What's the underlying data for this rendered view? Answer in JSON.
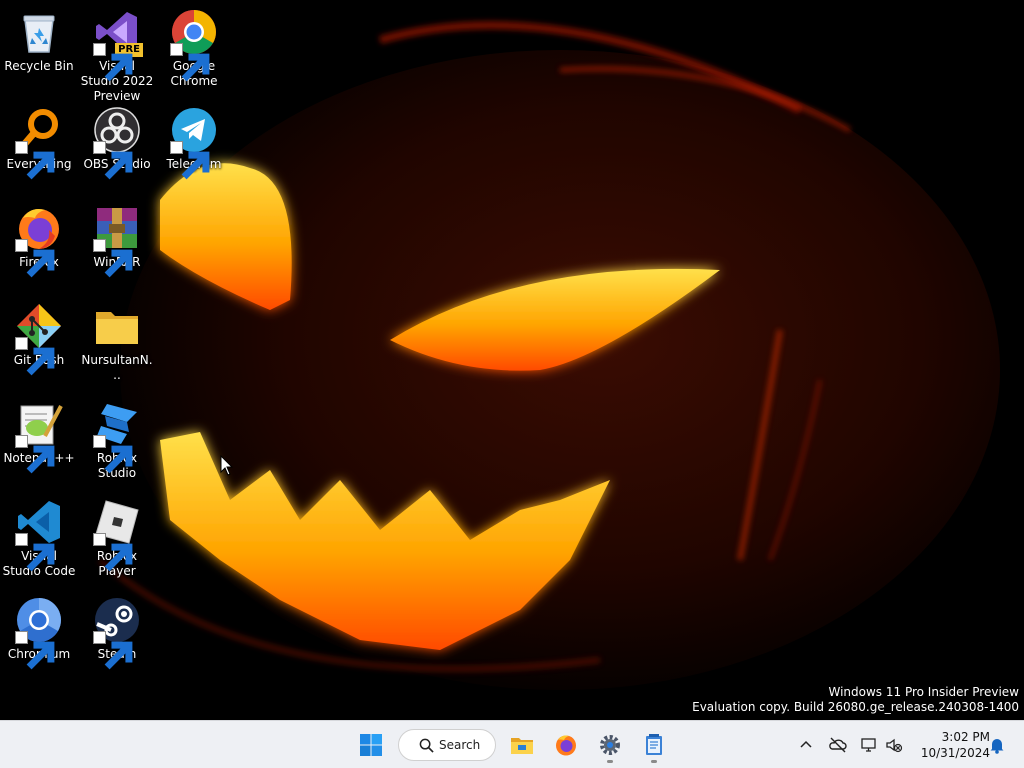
{
  "desktop": {
    "icons": [
      {
        "label": "Recycle Bin"
      },
      {
        "label": "Visual Studio 2022 Preview",
        "badge": "PRE"
      },
      {
        "label": "Google Chrome"
      },
      {
        "label": "Everything"
      },
      {
        "label": "OBS Studio"
      },
      {
        "label": "Telegram"
      },
      {
        "label": "Firefox"
      },
      {
        "label": "WinRAR"
      },
      {
        "label": "Git Bash"
      },
      {
        "label": "NursultanN..."
      },
      {
        "label": "Notepad++"
      },
      {
        "label": "Roblox Studio"
      },
      {
        "label": "Visual Studio Code"
      },
      {
        "label": "Roblox Player"
      },
      {
        "label": "Chromium"
      },
      {
        "label": "Steam"
      }
    ]
  },
  "watermark": {
    "line1": "Windows 11 Pro Insider Preview",
    "line2": "Evaluation copy. Build 26080.ge_release.240308-1400"
  },
  "taskbar": {
    "search_label": "Search",
    "apps": [
      "start-icon",
      "file-explorer-icon",
      "firefox-icon",
      "settings-icon",
      "notepad-icon"
    ]
  },
  "clock": {
    "time": "3:02 PM",
    "date": "10/31/2024"
  },
  "colors": {
    "taskbar_bg": "#eef0f4",
    "accent": "#0078d4",
    "pumpkin_glow": "#ffb000"
  }
}
